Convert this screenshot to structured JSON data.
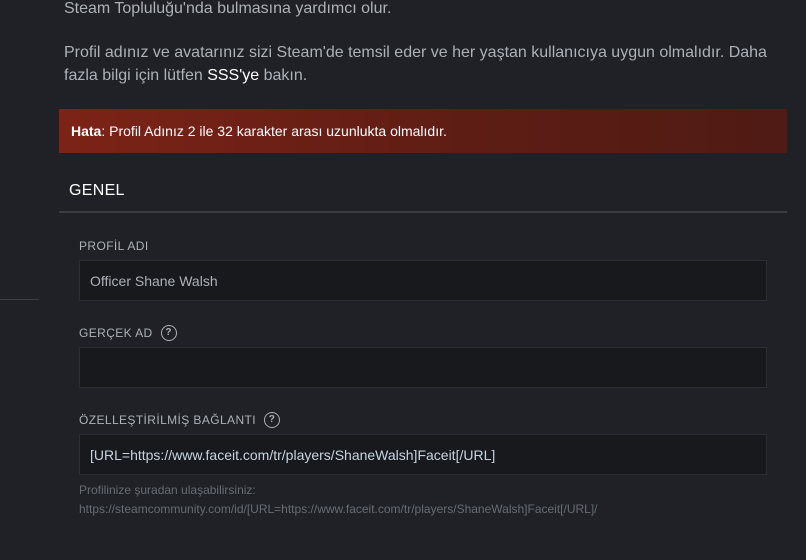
{
  "intro": {
    "line1": "Steam Topluluğu'nda bulmasına yardımcı olur.",
    "paragraph2_prefix": "Profil adınız ve avatarınız sizi Steam'de temsil eder ve her yaştan kullanıcıya uygun olmalıdır. Daha fazla bilgi için lütfen ",
    "faq_link": "SSS'ye",
    "paragraph2_suffix": " bakın."
  },
  "error": {
    "label": "Hata",
    "colon": ":",
    "message": " Profil Adınız 2 ile 32 karakter arası uzunlukta olmalıdır."
  },
  "section": {
    "title": "GENEL"
  },
  "fields": {
    "profile_name": {
      "label": "PROFİL ADI",
      "value": "Officer Shane Walsh"
    },
    "real_name": {
      "label": "GERÇEK AD",
      "help_icon": "question-circle-icon",
      "value": ""
    },
    "custom_url": {
      "label": "ÖZELLEŞTİRİLMİŞ BAĞLANTI",
      "help_icon": "question-circle-icon",
      "value": "[URL=https://www.faceit.com/tr/players/ShaneWalsh]Faceit[/URL]"
    }
  },
  "hint": {
    "line1": "Profilinize şuradan ulaşabilirsiniz:",
    "line2": "https://steamcommunity.com/id/[URL=https://www.faceit.com/tr/players/ShaneWalsh]Faceit[/URL]/"
  },
  "colors": {
    "background": "#1f2126",
    "error_bg": "#7d2317",
    "input_bg": "#18191d",
    "text": "#acb2b8"
  }
}
